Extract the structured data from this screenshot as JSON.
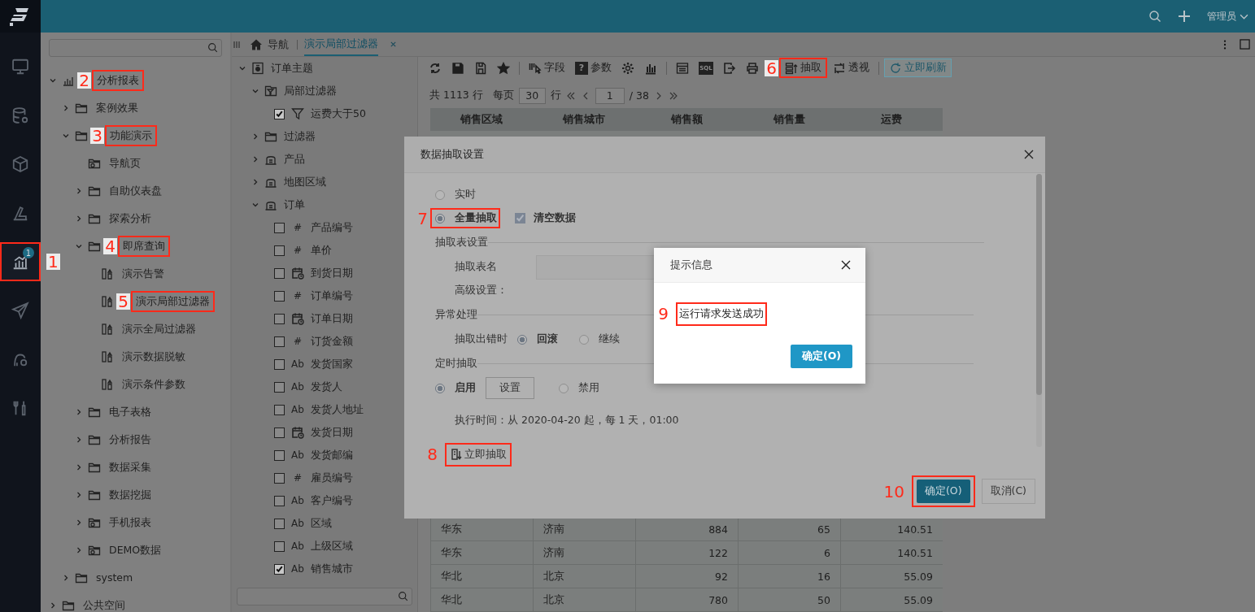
{
  "top_bar": {
    "user": "管理员"
  },
  "rail": [
    {
      "kind": "monitor",
      "selected": false
    },
    {
      "kind": "database",
      "selected": false
    },
    {
      "kind": "cube",
      "selected": false
    },
    {
      "kind": "ruler",
      "selected": false
    },
    {
      "kind": "chart",
      "selected": true,
      "badge": "1",
      "marker": "1"
    },
    {
      "kind": "send",
      "selected": false
    },
    {
      "kind": "person-gear",
      "selected": false
    },
    {
      "kind": "tools",
      "selected": false
    }
  ],
  "nav_tree": [
    {
      "kind": "root",
      "label": "分析报表",
      "expanded": true,
      "marker": "2",
      "children": [
        {
          "kind": "folder",
          "label": "案例效果",
          "expanded": false
        },
        {
          "kind": "folder",
          "label": "功能演示",
          "expanded": true,
          "marker": "3",
          "children": [
            {
              "kind": "app-folder",
              "label": "导航页"
            },
            {
              "kind": "folder",
              "label": "自助仪表盘",
              "expanded": false
            },
            {
              "kind": "folder",
              "label": "探索分析",
              "expanded": false
            },
            {
              "kind": "folder",
              "label": "即席查询",
              "expanded": true,
              "marker": "4",
              "children": [
                {
                  "kind": "report",
                  "label": "演示告警"
                },
                {
                  "kind": "report",
                  "label": "演示局部过滤器",
                  "marker": "5"
                },
                {
                  "kind": "report",
                  "label": "演示全局过滤器"
                },
                {
                  "kind": "report",
                  "label": "演示数据脱敏"
                },
                {
                  "kind": "report",
                  "label": "演示条件参数"
                }
              ]
            },
            {
              "kind": "folder",
              "label": "电子表格",
              "expanded": false
            },
            {
              "kind": "folder",
              "label": "分析报告",
              "expanded": false
            },
            {
              "kind": "folder",
              "label": "数据采集",
              "expanded": false
            },
            {
              "kind": "folder",
              "label": "数据挖掘",
              "expanded": false
            },
            {
              "kind": "app-folder",
              "label": "手机报表",
              "expanded": false
            },
            {
              "kind": "app-folder",
              "label": "DEMO数据",
              "expanded": false
            }
          ]
        },
        {
          "kind": "folder",
          "label": "system",
          "expanded": false
        }
      ]
    },
    {
      "kind": "folder",
      "label": "公共空间",
      "expanded": false
    }
  ],
  "tabs": {
    "home": "导航",
    "items": [
      {
        "label": "演示局部过滤器",
        "selected": true
      }
    ]
  },
  "field_tree": [
    {
      "kind": "subject",
      "label": "订单主题",
      "expanded": true,
      "children": [
        {
          "kind": "filter-folder",
          "label": "局部过滤器",
          "expanded": true,
          "children": [
            {
              "kind": "filter",
              "label": "运费大于50",
              "checked": true
            }
          ]
        },
        {
          "kind": "folder",
          "label": "过滤器",
          "expanded": false
        },
        {
          "kind": "table",
          "label": "产品",
          "expanded": false
        },
        {
          "kind": "table",
          "label": "地图区域",
          "expanded": false
        },
        {
          "kind": "table",
          "label": "订单",
          "expanded": true,
          "children": [
            {
              "kind": "field",
              "glyph": "#",
              "label": "产品编号",
              "checked": false
            },
            {
              "kind": "field",
              "glyph": "#",
              "label": "单价",
              "checked": false
            },
            {
              "kind": "date",
              "label": "到货日期",
              "checked": false
            },
            {
              "kind": "field",
              "glyph": "#",
              "label": "订单编号",
              "checked": false
            },
            {
              "kind": "date",
              "label": "订单日期",
              "checked": false
            },
            {
              "kind": "field",
              "glyph": "#",
              "label": "订货金额",
              "checked": false
            },
            {
              "kind": "field",
              "glyph": "Ab",
              "label": "发货国家",
              "checked": false
            },
            {
              "kind": "field",
              "glyph": "Ab",
              "label": "发货人",
              "checked": false
            },
            {
              "kind": "field",
              "glyph": "Ab",
              "label": "发货人地址",
              "checked": false
            },
            {
              "kind": "date",
              "label": "发货日期",
              "checked": false
            },
            {
              "kind": "field",
              "glyph": "Ab",
              "label": "发货邮编",
              "checked": false
            },
            {
              "kind": "field",
              "glyph": "#",
              "label": "雇员编号",
              "checked": false
            },
            {
              "kind": "field",
              "glyph": "Ab",
              "label": "客户编号",
              "checked": false
            },
            {
              "kind": "field",
              "glyph": "Ab",
              "label": "区域",
              "checked": false
            },
            {
              "kind": "field",
              "glyph": "Ab",
              "label": "上级区域",
              "checked": false
            },
            {
              "kind": "field",
              "glyph": "Ab",
              "label": "销售城市",
              "checked": true
            }
          ]
        }
      ]
    }
  ],
  "toolbar": [
    {
      "kind": "refresh"
    },
    {
      "kind": "save"
    },
    {
      "kind": "save-as"
    },
    {
      "kind": "star"
    },
    {
      "kind": "separator"
    },
    {
      "kind": "fields",
      "label": "字段"
    },
    {
      "kind": "params",
      "glyph": "?",
      "label": "参数"
    },
    {
      "kind": "gear"
    },
    {
      "kind": "bar-chart"
    },
    {
      "kind": "separator"
    },
    {
      "kind": "layout"
    },
    {
      "kind": "sql",
      "glyph": "SQL"
    },
    {
      "kind": "export"
    },
    {
      "kind": "print"
    },
    {
      "kind": "extract",
      "label": "抽取",
      "marker": "6"
    },
    {
      "kind": "pivot",
      "label": "透视"
    },
    {
      "kind": "separator"
    },
    {
      "kind": "refresh-now",
      "label": "立即刷新"
    }
  ],
  "pager": {
    "total": "共 1113 行",
    "per_page_label": "每页",
    "per_page": "30",
    "unit": "行",
    "page": "1",
    "pages": "/ 38"
  },
  "table": {
    "columns": [
      "销售区域",
      "销售城市",
      "销售额",
      "销售量",
      "运费"
    ],
    "rows": [
      [
        "华东",
        "济南",
        "884",
        "65",
        "140.51"
      ],
      [
        "华东",
        "济南",
        "122",
        "6",
        "140.51"
      ],
      [
        "华北",
        "北京",
        "92",
        "16",
        "55.09"
      ],
      [
        "华北",
        "北京",
        "780",
        "50",
        "55.09"
      ]
    ]
  },
  "extract_dialog": {
    "title": "数据抽取设置",
    "modes": [
      {
        "label": "实时",
        "selected": false
      },
      {
        "label": "全量抽取",
        "selected": true,
        "marker": "7"
      }
    ],
    "clear_data": {
      "label": "清空数据",
      "checked": true
    },
    "table_section": "抽取表设置",
    "table_name_label": "抽取表名",
    "advanced_label": "高级设置：",
    "error_section": "异常处理",
    "error_label": "抽取出错时",
    "error_options": [
      {
        "label": "回滚",
        "selected": true
      },
      {
        "label": "继续",
        "selected": false
      }
    ],
    "schedule_section": "定时抽取",
    "schedule_options": [
      {
        "label": "启用",
        "selected": true
      },
      {
        "label": "禁用",
        "selected": false
      }
    ],
    "schedule_button": "设置",
    "schedule_text": "执行时间：从 2020-04-20 起，每 1 天，01:00",
    "extract_now": {
      "label": "立即抽取",
      "marker": "8"
    },
    "ok": {
      "label": "确定(O)",
      "marker": "10"
    },
    "cancel": "取消(C)"
  },
  "message_dialog": {
    "title": "提示信息",
    "message": "运行请求发送成功",
    "marker": "9",
    "ok": "确定(O)"
  }
}
